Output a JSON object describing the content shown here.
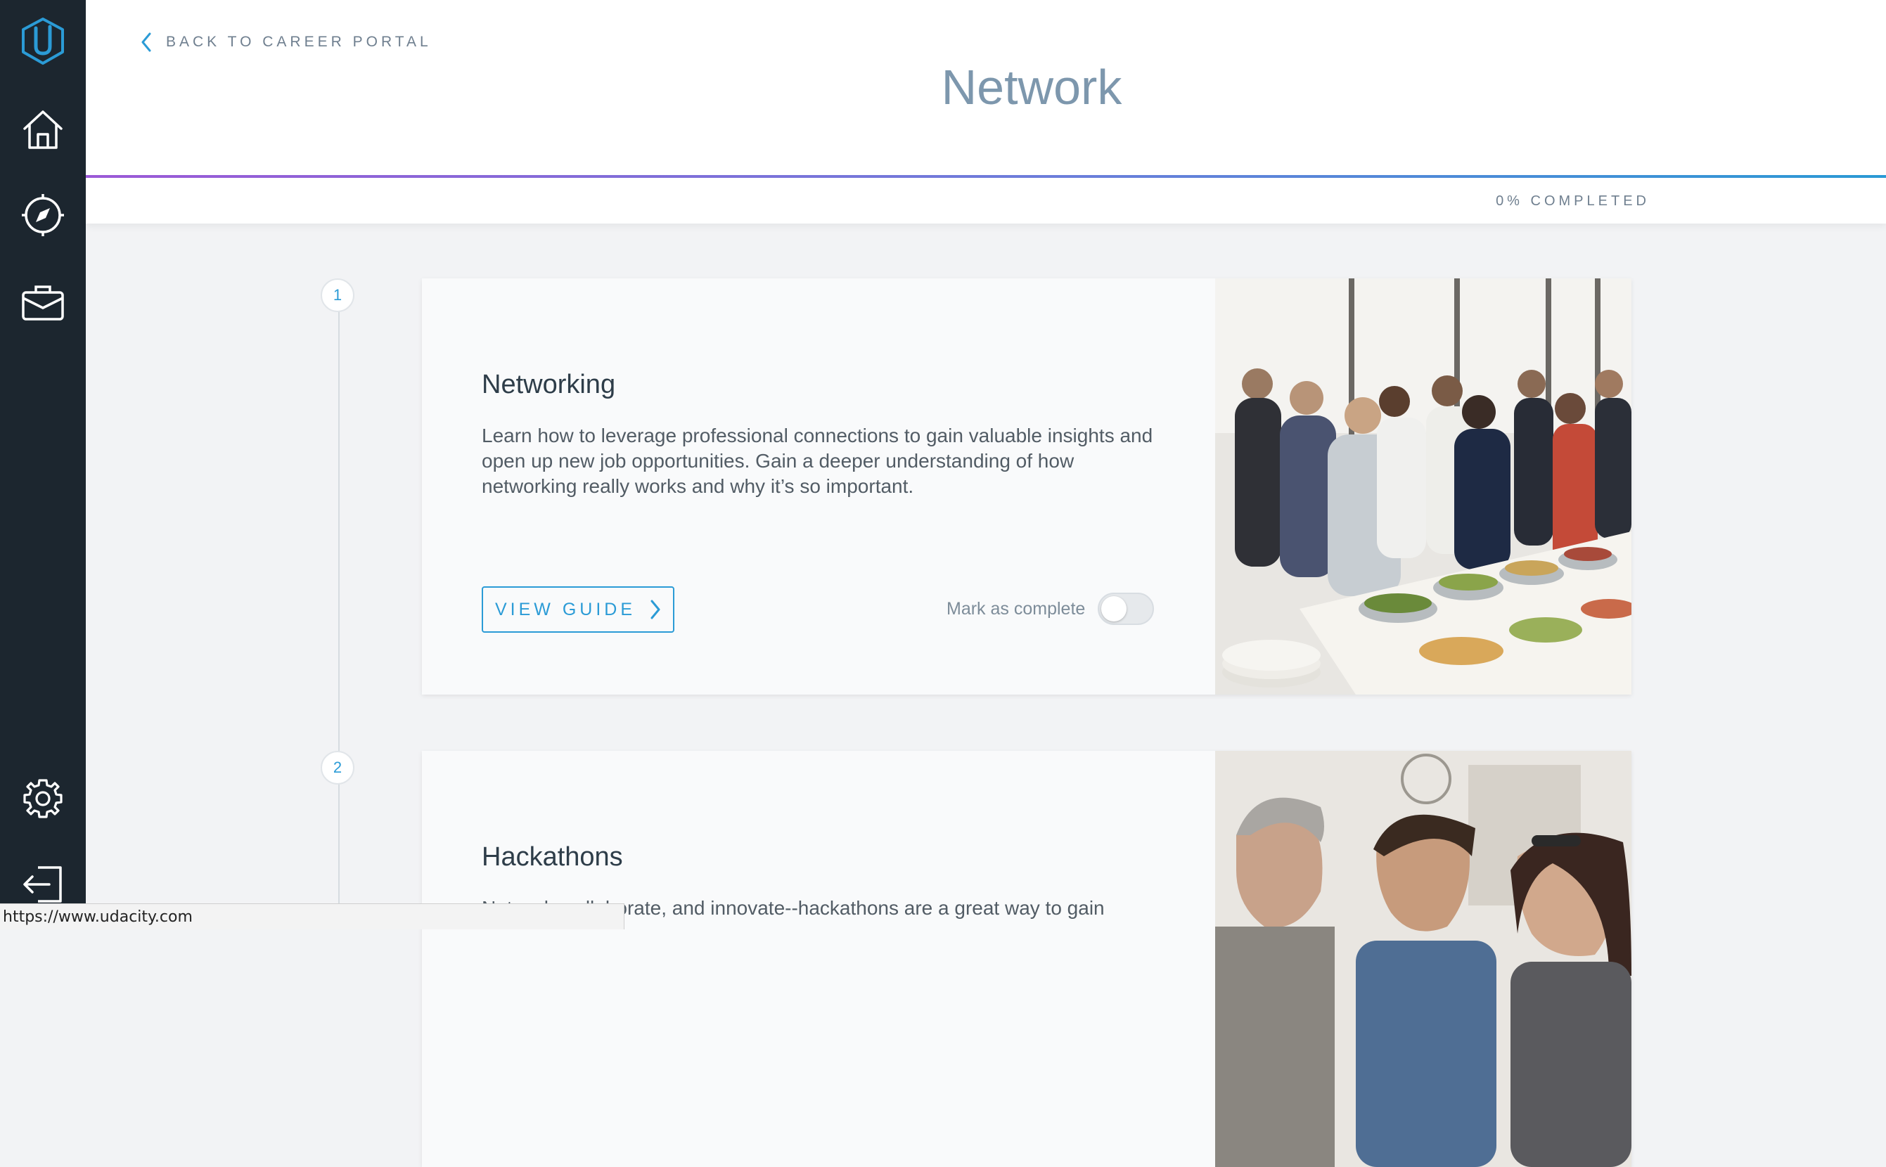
{
  "app": {
    "brand_icon": "udacity-logo-icon",
    "accent": "#2b9bd6"
  },
  "sidebar": {
    "top_items": [
      {
        "icon": "home-icon"
      },
      {
        "icon": "compass-icon"
      },
      {
        "icon": "briefcase-icon"
      }
    ],
    "bottom_items": [
      {
        "icon": "gear-icon"
      },
      {
        "icon": "logout-icon"
      }
    ]
  },
  "header": {
    "back_label": "BACK TO CAREER PORTAL",
    "title": "Network",
    "progress_text": "0% COMPLETED",
    "progress_value": 0
  },
  "steps": [
    {
      "number": "1",
      "title": "Networking",
      "description": "Learn how to leverage professional connections to gain valuable insights and open up new job opportunities. Gain a deeper understanding of how networking really works and why it’s so important.",
      "button_label": "VIEW GUIDE",
      "mark_label": "Mark as complete",
      "completed": false
    },
    {
      "number": "2",
      "title": "Hackathons",
      "description": "Network, collaborate, and innovate--hackathons are a great way to gain"
    }
  ],
  "status_bar": {
    "url": "https://www.udacity.com"
  }
}
